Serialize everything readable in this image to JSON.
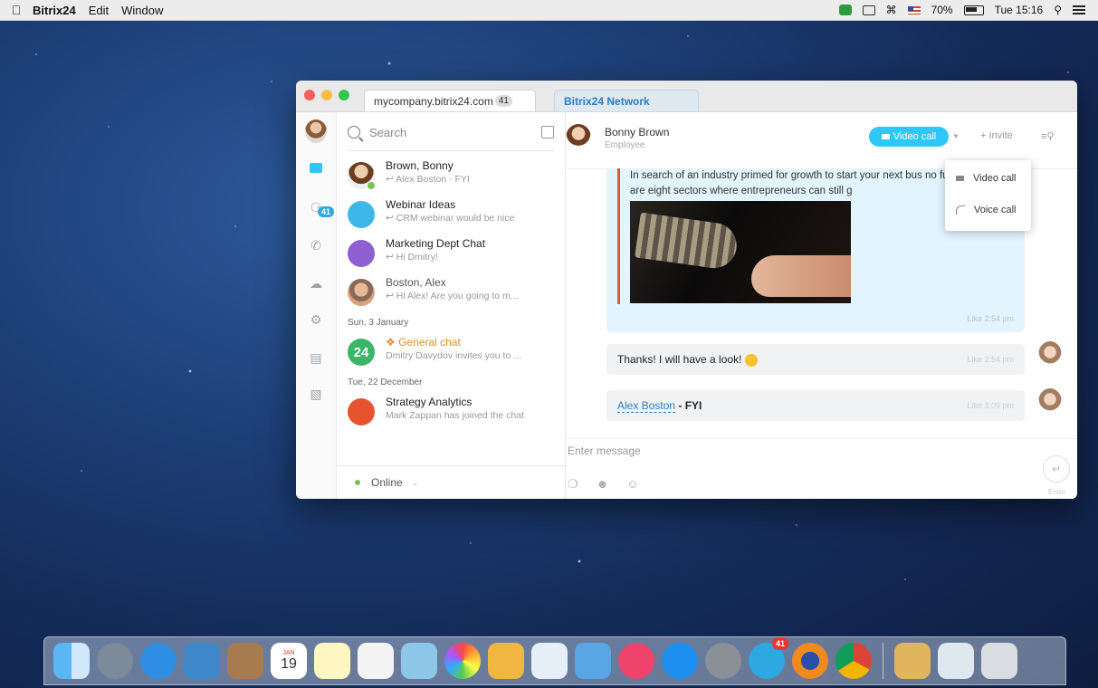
{
  "menubar": {
    "app": "Bitrix24",
    "items": [
      "Edit",
      "Window"
    ],
    "battery": "70%",
    "clock": "Tue 15:16"
  },
  "tabs": [
    {
      "label": "mycompany.bitrix24.com",
      "count": "41"
    },
    {
      "label": "Bitrix24 Network"
    }
  ],
  "rail": {
    "badge": "41"
  },
  "chatlist": {
    "search_placeholder": "Search",
    "items": [
      {
        "name": "Brown, Bonny",
        "preview": "↩ Alex Boston - FYI"
      },
      {
        "name": "Webinar Ideas",
        "preview": "↩ CRM webinar would be nice"
      },
      {
        "name": "Marketing Dept Chat",
        "preview": "↩ Hi Dmitry!"
      },
      {
        "name": "Boston, Alex",
        "preview": "↩ Hi Alex! Are you going to m..."
      }
    ],
    "date1": "Sun, 3 January",
    "general": {
      "avatar": "24",
      "name": "General chat",
      "preview": "Dmitry Davydov invites you to ..."
    },
    "date2": "Tue, 22 December",
    "strategy": {
      "name": "Strategy Analytics",
      "preview": "Mark Zappan has joined the chat"
    },
    "status": "Online"
  },
  "chat": {
    "contact": "Bonny Brown",
    "role": "Employee",
    "video_call": "Video call",
    "invite": "Invite",
    "message1": "In search of an industry primed for growth to start your next bus no further. Here are eight sectors where entrepreneurs can still g",
    "message1_meta": "Like  2:54 pm",
    "message2": "Thanks! I will have a look!",
    "message2_meta": "Like  2:54 pm",
    "message3_link": "Alex Boston",
    "message3_rest": " - FYI",
    "message3_meta": "Like  3:09 pm",
    "composer_placeholder": "Enter message",
    "enter_label": "Enter"
  },
  "call_menu": {
    "video": "Video call",
    "voice": "Voice call"
  },
  "dock": {
    "calendar_day": "19",
    "calendar_month": "JAN",
    "badge": "41"
  }
}
